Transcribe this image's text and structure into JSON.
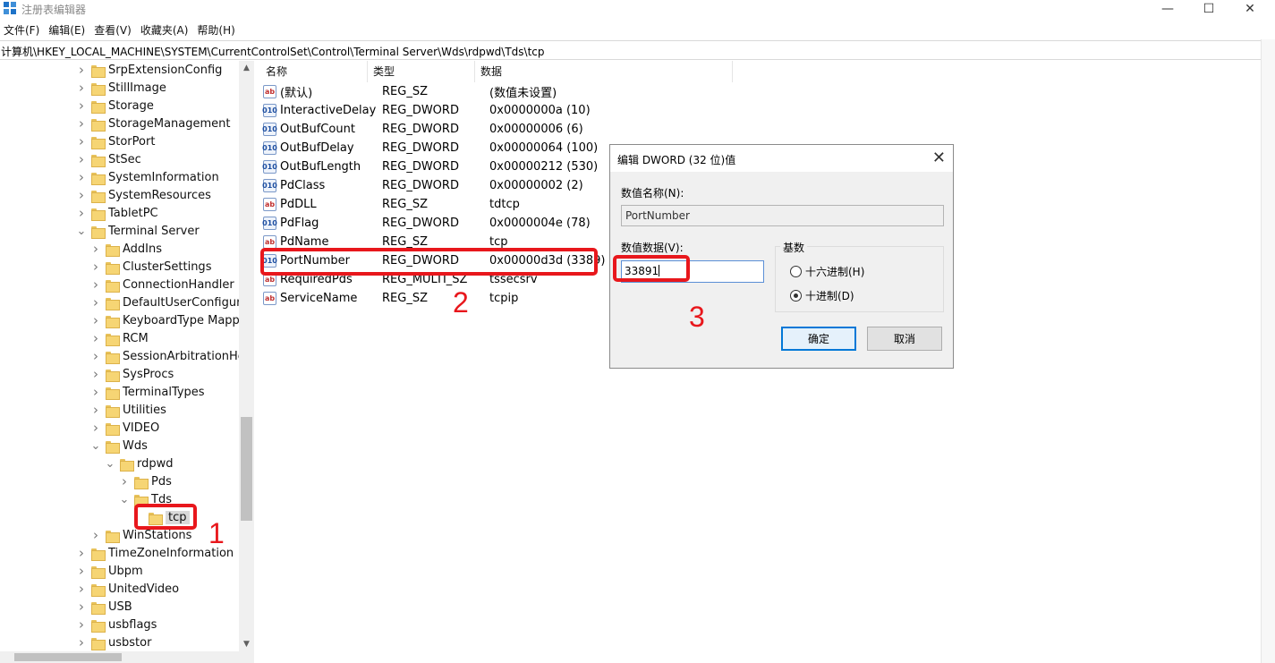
{
  "window": {
    "title": "注册表编辑器",
    "minimize": "—",
    "maximize": "☐",
    "close": "✕"
  },
  "menu": [
    "文件(F)",
    "编辑(E)",
    "查看(V)",
    "收藏夹(A)",
    "帮助(H)"
  ],
  "address": "计算机\\HKEY_LOCAL_MACHINE\\SYSTEM\\CurrentControlSet\\Control\\Terminal Server\\Wds\\rdpwd\\Tds\\tcp",
  "tree": [
    {
      "label": "SrpExtensionConfig",
      "level": 1,
      "state": "collapsed"
    },
    {
      "label": "StillImage",
      "level": 1,
      "state": "collapsed"
    },
    {
      "label": "Storage",
      "level": 1,
      "state": "collapsed"
    },
    {
      "label": "StorageManagement",
      "level": 1,
      "state": "collapsed"
    },
    {
      "label": "StorPort",
      "level": 1,
      "state": "collapsed"
    },
    {
      "label": "StSec",
      "level": 1,
      "state": "collapsed"
    },
    {
      "label": "SystemInformation",
      "level": 1,
      "state": "collapsed"
    },
    {
      "label": "SystemResources",
      "level": 1,
      "state": "collapsed"
    },
    {
      "label": "TabletPC",
      "level": 1,
      "state": "collapsed"
    },
    {
      "label": "Terminal Server",
      "level": 1,
      "state": "expanded"
    },
    {
      "label": "AddIns",
      "level": 2,
      "state": "collapsed"
    },
    {
      "label": "ClusterSettings",
      "level": 2,
      "state": "collapsed"
    },
    {
      "label": "ConnectionHandler",
      "level": 2,
      "state": "collapsed"
    },
    {
      "label": "DefaultUserConfigurati",
      "level": 2,
      "state": "collapsed"
    },
    {
      "label": "KeyboardType Mappin",
      "level": 2,
      "state": "collapsed"
    },
    {
      "label": "RCM",
      "level": 2,
      "state": "collapsed"
    },
    {
      "label": "SessionArbitrationHelp",
      "level": 2,
      "state": "collapsed"
    },
    {
      "label": "SysProcs",
      "level": 2,
      "state": "collapsed"
    },
    {
      "label": "TerminalTypes",
      "level": 2,
      "state": "collapsed"
    },
    {
      "label": "Utilities",
      "level": 2,
      "state": "collapsed"
    },
    {
      "label": "VIDEO",
      "level": 2,
      "state": "collapsed"
    },
    {
      "label": "Wds",
      "level": 2,
      "state": "expanded"
    },
    {
      "label": "rdpwd",
      "level": 3,
      "state": "expanded"
    },
    {
      "label": "Pds",
      "level": 4,
      "state": "collapsed"
    },
    {
      "label": "Tds",
      "level": 4,
      "state": "expanded"
    },
    {
      "label": "tcp",
      "level": 5,
      "state": "leaf",
      "selected": true
    },
    {
      "label": "WinStations",
      "level": 2,
      "state": "collapsed"
    },
    {
      "label": "TimeZoneInformation",
      "level": 1,
      "state": "collapsed"
    },
    {
      "label": "Ubpm",
      "level": 1,
      "state": "collapsed"
    },
    {
      "label": "UnitedVideo",
      "level": 1,
      "state": "collapsed"
    },
    {
      "label": "USB",
      "level": 1,
      "state": "collapsed"
    },
    {
      "label": "usbflags",
      "level": 1,
      "state": "collapsed"
    },
    {
      "label": "usbstor",
      "level": 1,
      "state": "collapsed"
    }
  ],
  "list": {
    "headers": {
      "name": "名称",
      "type": "类型",
      "data": "数据"
    },
    "rows": [
      {
        "icon": "ab",
        "kind": "sz",
        "name": "(默认)",
        "type": "REG_SZ",
        "data": "(数值未设置)"
      },
      {
        "icon": "010",
        "kind": "dword",
        "name": "InteractiveDelay",
        "type": "REG_DWORD",
        "data": "0x0000000a (10)"
      },
      {
        "icon": "010",
        "kind": "dword",
        "name": "OutBufCount",
        "type": "REG_DWORD",
        "data": "0x00000006 (6)"
      },
      {
        "icon": "010",
        "kind": "dword",
        "name": "OutBufDelay",
        "type": "REG_DWORD",
        "data": "0x00000064 (100)"
      },
      {
        "icon": "010",
        "kind": "dword",
        "name": "OutBufLength",
        "type": "REG_DWORD",
        "data": "0x00000212 (530)"
      },
      {
        "icon": "010",
        "kind": "dword",
        "name": "PdClass",
        "type": "REG_DWORD",
        "data": "0x00000002 (2)"
      },
      {
        "icon": "ab",
        "kind": "sz",
        "name": "PdDLL",
        "type": "REG_SZ",
        "data": "tdtcp"
      },
      {
        "icon": "010",
        "kind": "dword",
        "name": "PdFlag",
        "type": "REG_DWORD",
        "data": "0x0000004e (78)"
      },
      {
        "icon": "ab",
        "kind": "sz",
        "name": "PdName",
        "type": "REG_SZ",
        "data": "tcp"
      },
      {
        "icon": "010",
        "kind": "dword",
        "name": "PortNumber",
        "type": "REG_DWORD",
        "data": "0x00000d3d (3389)"
      },
      {
        "icon": "ab",
        "kind": "sz",
        "name": "RequiredPds",
        "type": "REG_MULTI_SZ",
        "data": "tssecsrv"
      },
      {
        "icon": "ab",
        "kind": "sz",
        "name": "ServiceName",
        "type": "REG_SZ",
        "data": "tcpip"
      }
    ]
  },
  "dialog": {
    "title": "编辑 DWORD (32 位)值",
    "close": "✕",
    "name_label": "数值名称(N):",
    "name_value": "PortNumber",
    "data_label": "数值数据(V):",
    "data_value": "33891",
    "base_label": "基数",
    "radio_hex": "十六进制(H)",
    "radio_dec": "十进制(D)",
    "selected_base": "dec",
    "ok": "确定",
    "cancel": "取消"
  },
  "annotations": {
    "step1": "1",
    "step2": "2",
    "step3": "3",
    "color": "#e8171c"
  }
}
